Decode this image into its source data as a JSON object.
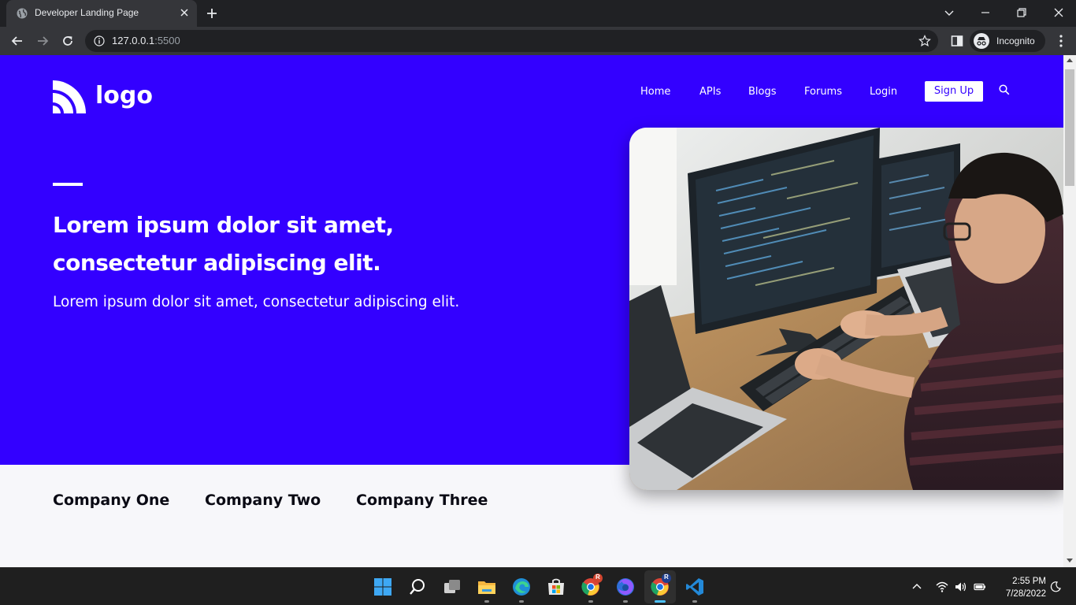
{
  "browser": {
    "tab_title": "Developer Landing Page",
    "url_host": "127.0.0.1",
    "url_port": ":5500",
    "profile_label": "Incognito"
  },
  "site": {
    "logo_text": "logo",
    "nav": [
      "Home",
      "APIs",
      "Blogs",
      "Forums",
      "Login"
    ],
    "signup_label": "Sign Up",
    "headline_line1": "Lorem ipsum dolor sit amet,",
    "headline_line2": "consectetur adipiscing elit.",
    "subheadline": "Lorem ipsum dolor sit amet, consectetur adipiscing elit.",
    "companies": [
      "Company One",
      "Company Two",
      "Company Three"
    ]
  },
  "taskbar": {
    "time": "2:55 PM",
    "date": "7/28/2022",
    "badge_letter": "R"
  },
  "colors": {
    "hero_bg": "#3300ff",
    "page_bg": "#f7f7fa",
    "chrome_dark": "#202124",
    "chrome_toolbar": "#35363a",
    "taskbar_accent": "#4cc2ff"
  }
}
